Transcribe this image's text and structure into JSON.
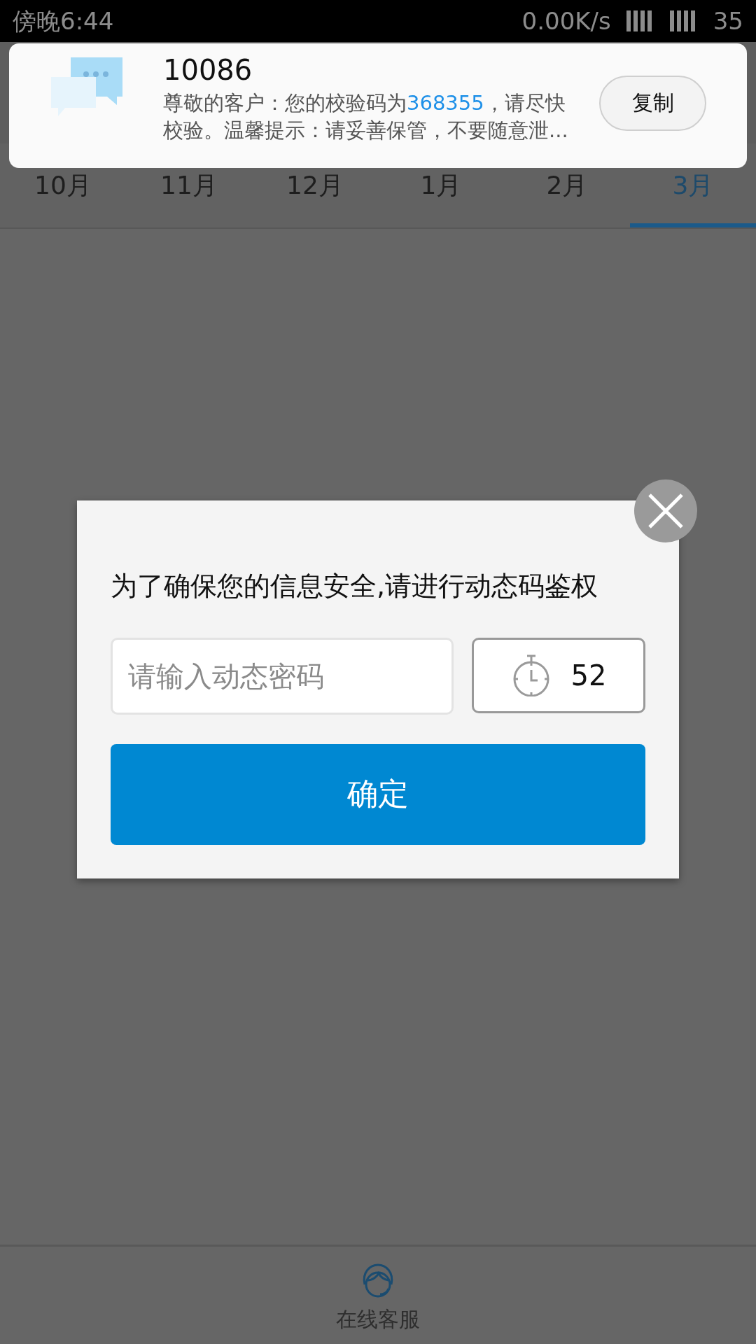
{
  "status_bar": {
    "time": "傍晚6:44",
    "speed": "0.00K/s",
    "battery": "35"
  },
  "notification": {
    "title": "10086",
    "message": {
      "prefix": "尊敬的客户：您的校验码为",
      "code": "368355",
      "suffix": "，请尽快校验。温馨提示：请妥善保管，不要随意泄..."
    },
    "action": "复制"
  },
  "tabs": [
    {
      "label": "10月",
      "selected": false
    },
    {
      "label": "11月",
      "selected": false
    },
    {
      "label": "12月",
      "selected": false
    },
    {
      "label": "1月",
      "selected": false
    },
    {
      "label": "2月",
      "selected": false
    },
    {
      "label": "3月",
      "selected": true
    }
  ],
  "dialog": {
    "message": "为了确保您的信息安全,请进行动态码鉴权",
    "input": {
      "placeholder": "请输入动态密码"
    },
    "countdown": "52",
    "confirm": "确定"
  },
  "bottom_bar": {
    "label": "在线客服"
  }
}
